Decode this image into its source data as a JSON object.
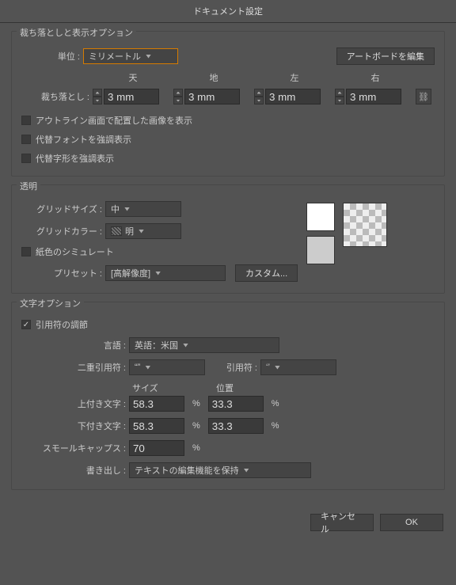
{
  "title": "ドキュメント設定",
  "bleed_group": {
    "title": "裁ち落としと表示オプション",
    "units_label": "単位 :",
    "units_value": "ミリメートル",
    "edit_artboard_btn": "アートボードを編集",
    "cols": {
      "top": "天",
      "bottom": "地",
      "left": "左",
      "right": "右"
    },
    "bleed_label": "裁ち落とし :",
    "bleed": {
      "top": "3 mm",
      "bottom": "3 mm",
      "left": "3 mm",
      "right": "3 mm"
    },
    "cb1": "アウトライン画面で配置した画像を表示",
    "cb2": "代替フォントを強調表示",
    "cb3": "代替字形を強調表示"
  },
  "trans_group": {
    "title": "透明",
    "grid_size_label": "グリッドサイズ :",
    "grid_size_value": "中",
    "grid_color_label": "グリッドカラー :",
    "grid_color_value": "明",
    "simulate_paper": "紙色のシミュレート",
    "preset_label": "プリセット :",
    "preset_value": "[高解像度]",
    "custom_btn": "カスタム..."
  },
  "text_group": {
    "title": "文字オプション",
    "adjust_quotes": "引用符の調節",
    "lang_label": "言語 :",
    "lang_value": "英語：米国",
    "dbl_quote_label": "二重引用符 :",
    "dbl_quote_value": "“”",
    "quote_label": "引用符 :",
    "quote_value": "‘’",
    "size_header": "サイズ",
    "pos_header": "位置",
    "superscript_label": "上付き文字 :",
    "superscript_size": "58.3",
    "superscript_pos": "33.3",
    "subscript_label": "下付き文字 :",
    "subscript_size": "58.3",
    "subscript_pos": "33.3",
    "smallcaps_label": "スモールキャップス :",
    "smallcaps_val": "70",
    "export_label": "書き出し :",
    "export_value": "テキストの編集機能を保持",
    "pct": "%"
  },
  "footer": {
    "cancel": "キャンセル",
    "ok": "OK"
  }
}
